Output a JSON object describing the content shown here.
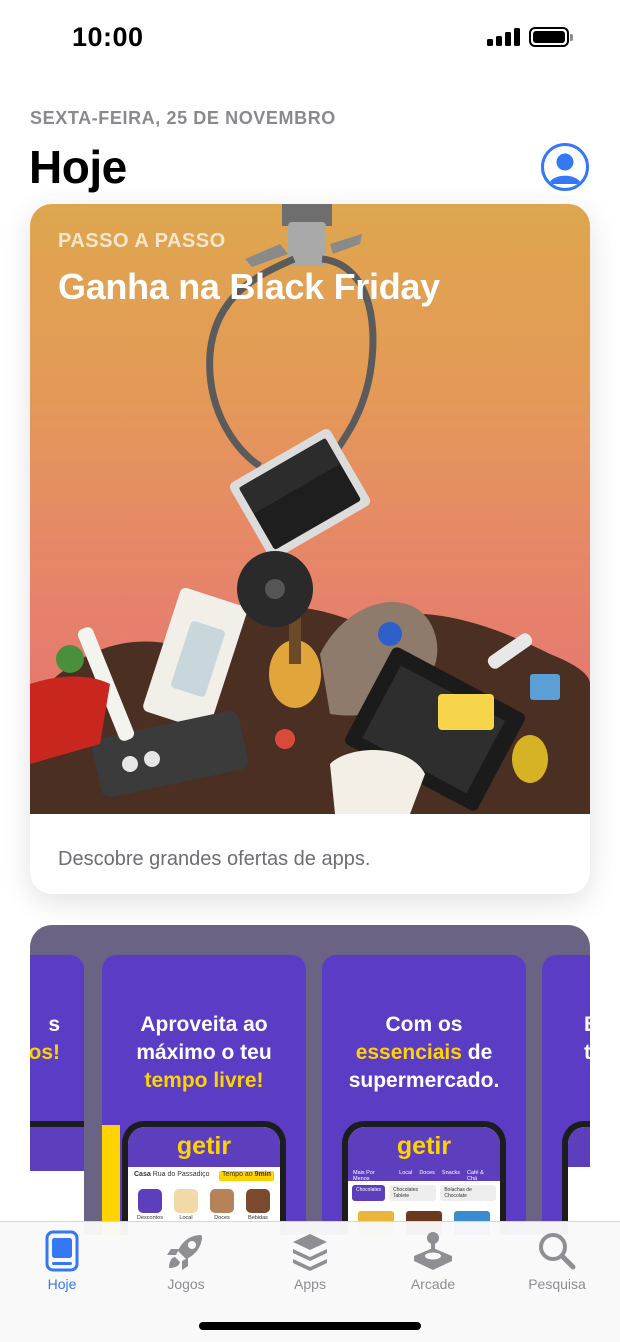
{
  "status_bar": {
    "time": "10:00"
  },
  "header": {
    "date": "SEXTA-FEIRA, 25 DE NOVEMBRO",
    "title": "Hoje",
    "account_icon": "person-circle-icon"
  },
  "feature_card": {
    "eyebrow": "PASSO A PASSO",
    "title": "Ganha na Black Friday",
    "caption": "Descobre grandes ofertas de apps.",
    "art_description_icon": "claw-machine-illustration"
  },
  "getir_card": {
    "brand": "getir",
    "shots": [
      {
        "line1": "s",
        "line2": "os!"
      },
      {
        "line1": "Aproveita ao",
        "line2": "máximo o teu",
        "highlight": "tempo livre!"
      },
      {
        "line1": "Com os",
        "highlight": "essenciais",
        "line2_suffix": " de",
        "line3": "supermercado."
      },
      {
        "line1": "B",
        "line2": "te"
      }
    ],
    "phone_a": {
      "address_label": "Casa",
      "address_value": "Rua do Passadiço",
      "eta_label": "Tempo ao",
      "eta_value": "9min",
      "categories": [
        "Descontos",
        "Local",
        "Doces",
        "Bebidas"
      ]
    },
    "phone_b": {
      "menu": [
        "Mais Por Menos",
        "Local",
        "Doces",
        "Snacks",
        "Café & Chá"
      ],
      "chips": [
        "Chocolates",
        "Chocolates Tablete",
        "Bolachas de Chocolate"
      ]
    },
    "left_partial": "O\n!"
  },
  "tab_bar": {
    "tabs": [
      {
        "label": "Hoje",
        "icon": "today-icon",
        "active": true
      },
      {
        "label": "Jogos",
        "icon": "rocket-icon",
        "active": false
      },
      {
        "label": "Apps",
        "icon": "layers-icon",
        "active": false
      },
      {
        "label": "Arcade",
        "icon": "joystick-icon",
        "active": false
      },
      {
        "label": "Pesquisa",
        "icon": "search-icon",
        "active": false
      }
    ]
  },
  "colors": {
    "accent": "#3478f6",
    "getir_purple": "#5d3ebc",
    "getir_yellow": "#ffd300"
  }
}
